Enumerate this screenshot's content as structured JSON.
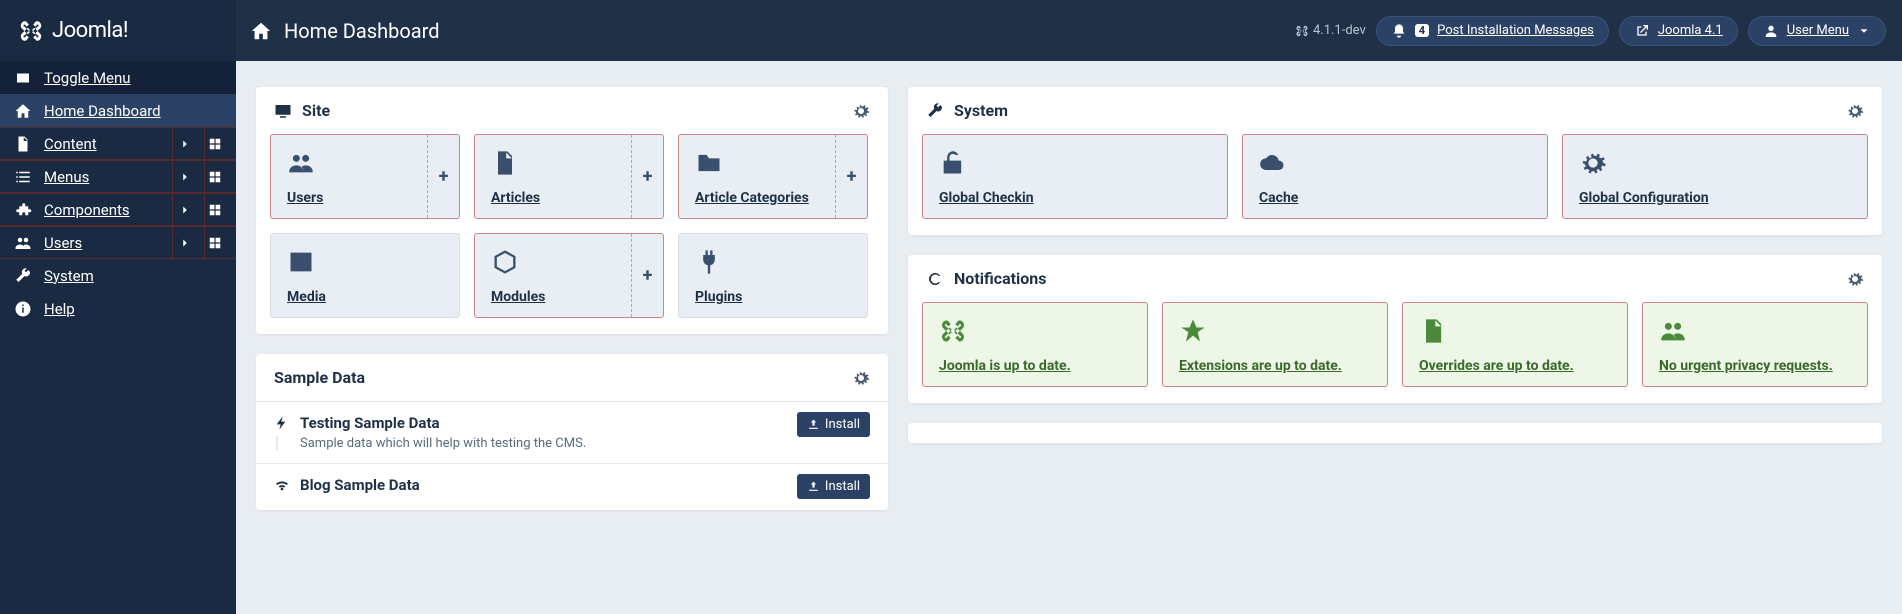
{
  "brand": "Joomla!",
  "page_title": "Home Dashboard",
  "version": "4.1.1-dev",
  "header": {
    "post_install_label": "Post Installation Messages",
    "post_install_count": "4",
    "site_label": "Joomla 4.1",
    "user_menu_label": "User Menu"
  },
  "sidebar": {
    "toggle": "Toggle Menu",
    "items": [
      {
        "label": "Home Dashboard",
        "icon": "home",
        "active": true,
        "expand": false,
        "dash": false
      },
      {
        "label": "Content",
        "icon": "file",
        "expand": true,
        "dash": true
      },
      {
        "label": "Menus",
        "icon": "list",
        "expand": true,
        "dash": true
      },
      {
        "label": "Components",
        "icon": "puzzle",
        "expand": true,
        "dash": true
      },
      {
        "label": "Users",
        "icon": "users",
        "expand": true,
        "dash": true
      },
      {
        "label": "System",
        "icon": "wrench",
        "expand": false,
        "dash": false
      },
      {
        "label": "Help",
        "icon": "info",
        "expand": false,
        "dash": false
      }
    ]
  },
  "panels": {
    "site": {
      "title": "Site",
      "cards": [
        {
          "label": "Users",
          "icon": "users",
          "plus": true,
          "red": true
        },
        {
          "label": "Articles",
          "icon": "file",
          "plus": true,
          "red": true
        },
        {
          "label": "Article Categories",
          "icon": "folder",
          "plus": true,
          "red": true
        },
        {
          "label": "Media",
          "icon": "image",
          "plus": false,
          "red": false
        },
        {
          "label": "Modules",
          "icon": "cube",
          "plus": true,
          "red": true
        },
        {
          "label": "Plugins",
          "icon": "plug",
          "plus": false,
          "red": false
        }
      ]
    },
    "system": {
      "title": "System",
      "cards": [
        {
          "label": "Global Checkin",
          "icon": "unlock",
          "red": true
        },
        {
          "label": "Cache",
          "icon": "cloud",
          "red": true
        },
        {
          "label": "Global Configuration",
          "icon": "cog",
          "red": true
        }
      ]
    },
    "notifications": {
      "title": "Notifications",
      "cards": [
        {
          "label": "Joomla is up to date.",
          "icon": "joomla",
          "red": true
        },
        {
          "label": "Extensions are up to date.",
          "icon": "star",
          "red": true
        },
        {
          "label": "Overrides are up to date.",
          "icon": "filealt",
          "red": true
        },
        {
          "label": "No urgent privacy requests.",
          "icon": "users",
          "red": true
        }
      ]
    },
    "sample": {
      "title": "Sample Data",
      "install_label": "Install",
      "items": [
        {
          "title": "Testing Sample Data",
          "desc": "Sample data which will help with testing the CMS.",
          "icon": "bolt"
        },
        {
          "title": "Blog Sample Data",
          "desc": "",
          "icon": "wifi"
        }
      ]
    }
  }
}
